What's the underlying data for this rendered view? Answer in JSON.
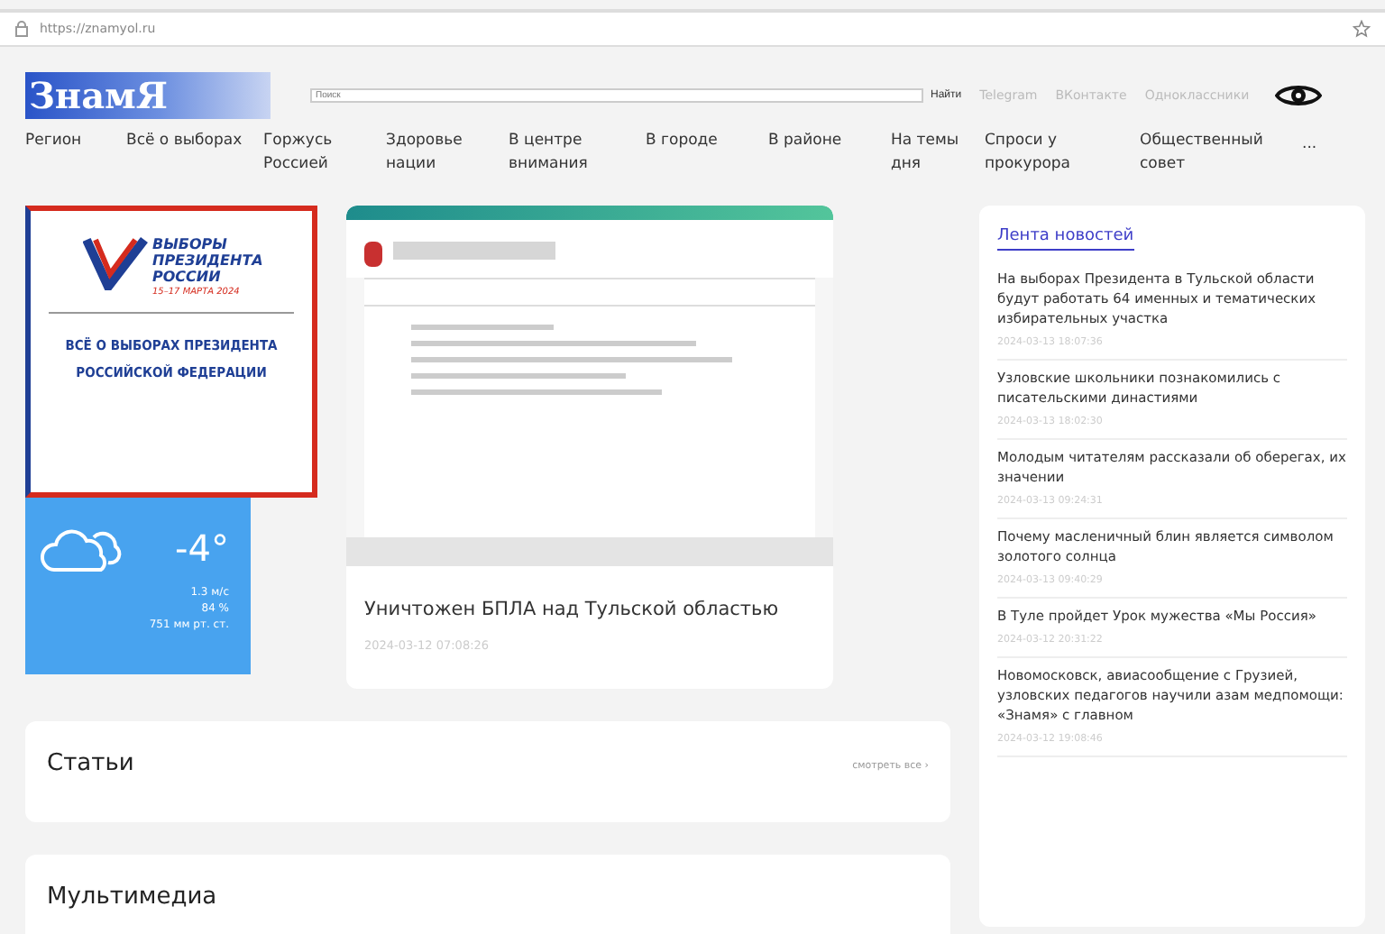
{
  "browser": {
    "url": "https://znamyol.ru"
  },
  "header": {
    "logo": "ЗнамЯ",
    "search": {
      "placeholder": "Поиск",
      "button": "Найти"
    },
    "links": [
      "Telegram",
      "ВКонтакте",
      "Одноклассники"
    ]
  },
  "nav": [
    "Регион",
    "Всё о выборах",
    "Горжусь Россией",
    "Здоровье нации",
    "В центре внимания",
    "В городе",
    "В районе",
    "На темы дня",
    "Спроси у прокурора",
    "Общественный совет",
    "..."
  ],
  "election_banner": {
    "title": "ВЫБОРЫ ПРЕЗИДЕНТА РОССИИ",
    "dates": "15–17 МАРТА 2024",
    "caption": "ВСЁ О ВЫБОРАХ ПРЕЗИДЕНТА РОССИЙСКОЙ ФЕДЕРАЦИИ"
  },
  "weather": {
    "temperature": "-4°",
    "wind": "1.3 м/с",
    "humidity": "84 %",
    "pressure": "751 мм рт. ст."
  },
  "main_news": {
    "title": "Уничтожен БПЛА над Тульской областью",
    "date": "2024-03-12 07:08:26"
  },
  "news_feed": {
    "title": "Лента новостей",
    "items": [
      {
        "title": "На выборах Президента в Тульской области будут работать 64 именных и тематических избирательных участка",
        "date": "2024-03-13 18:07:36"
      },
      {
        "title": "Узловские школьники познакомились с писательскими династиями",
        "date": "2024-03-13 18:02:30"
      },
      {
        "title": "Молодым читателям рассказали об оберегах, их значении",
        "date": "2024-03-13 09:24:31"
      },
      {
        "title": "Почему масленичный блин является символом золотого солнца",
        "date": "2024-03-13 09:40:29"
      },
      {
        "title": "В Туле пройдет Урок мужества «Мы Россия»",
        "date": "2024-03-12 20:31:22"
      },
      {
        "title": "Новомосковск, авиасообщение с Грузией, узловских педагогов научили азам медпомощи: «Знамя» с главном",
        "date": "2024-03-12 19:08:46"
      }
    ]
  },
  "sections": [
    {
      "title": "Статьи",
      "link": "смотреть все ›"
    },
    {
      "title": "Мультимедиа"
    }
  ]
}
